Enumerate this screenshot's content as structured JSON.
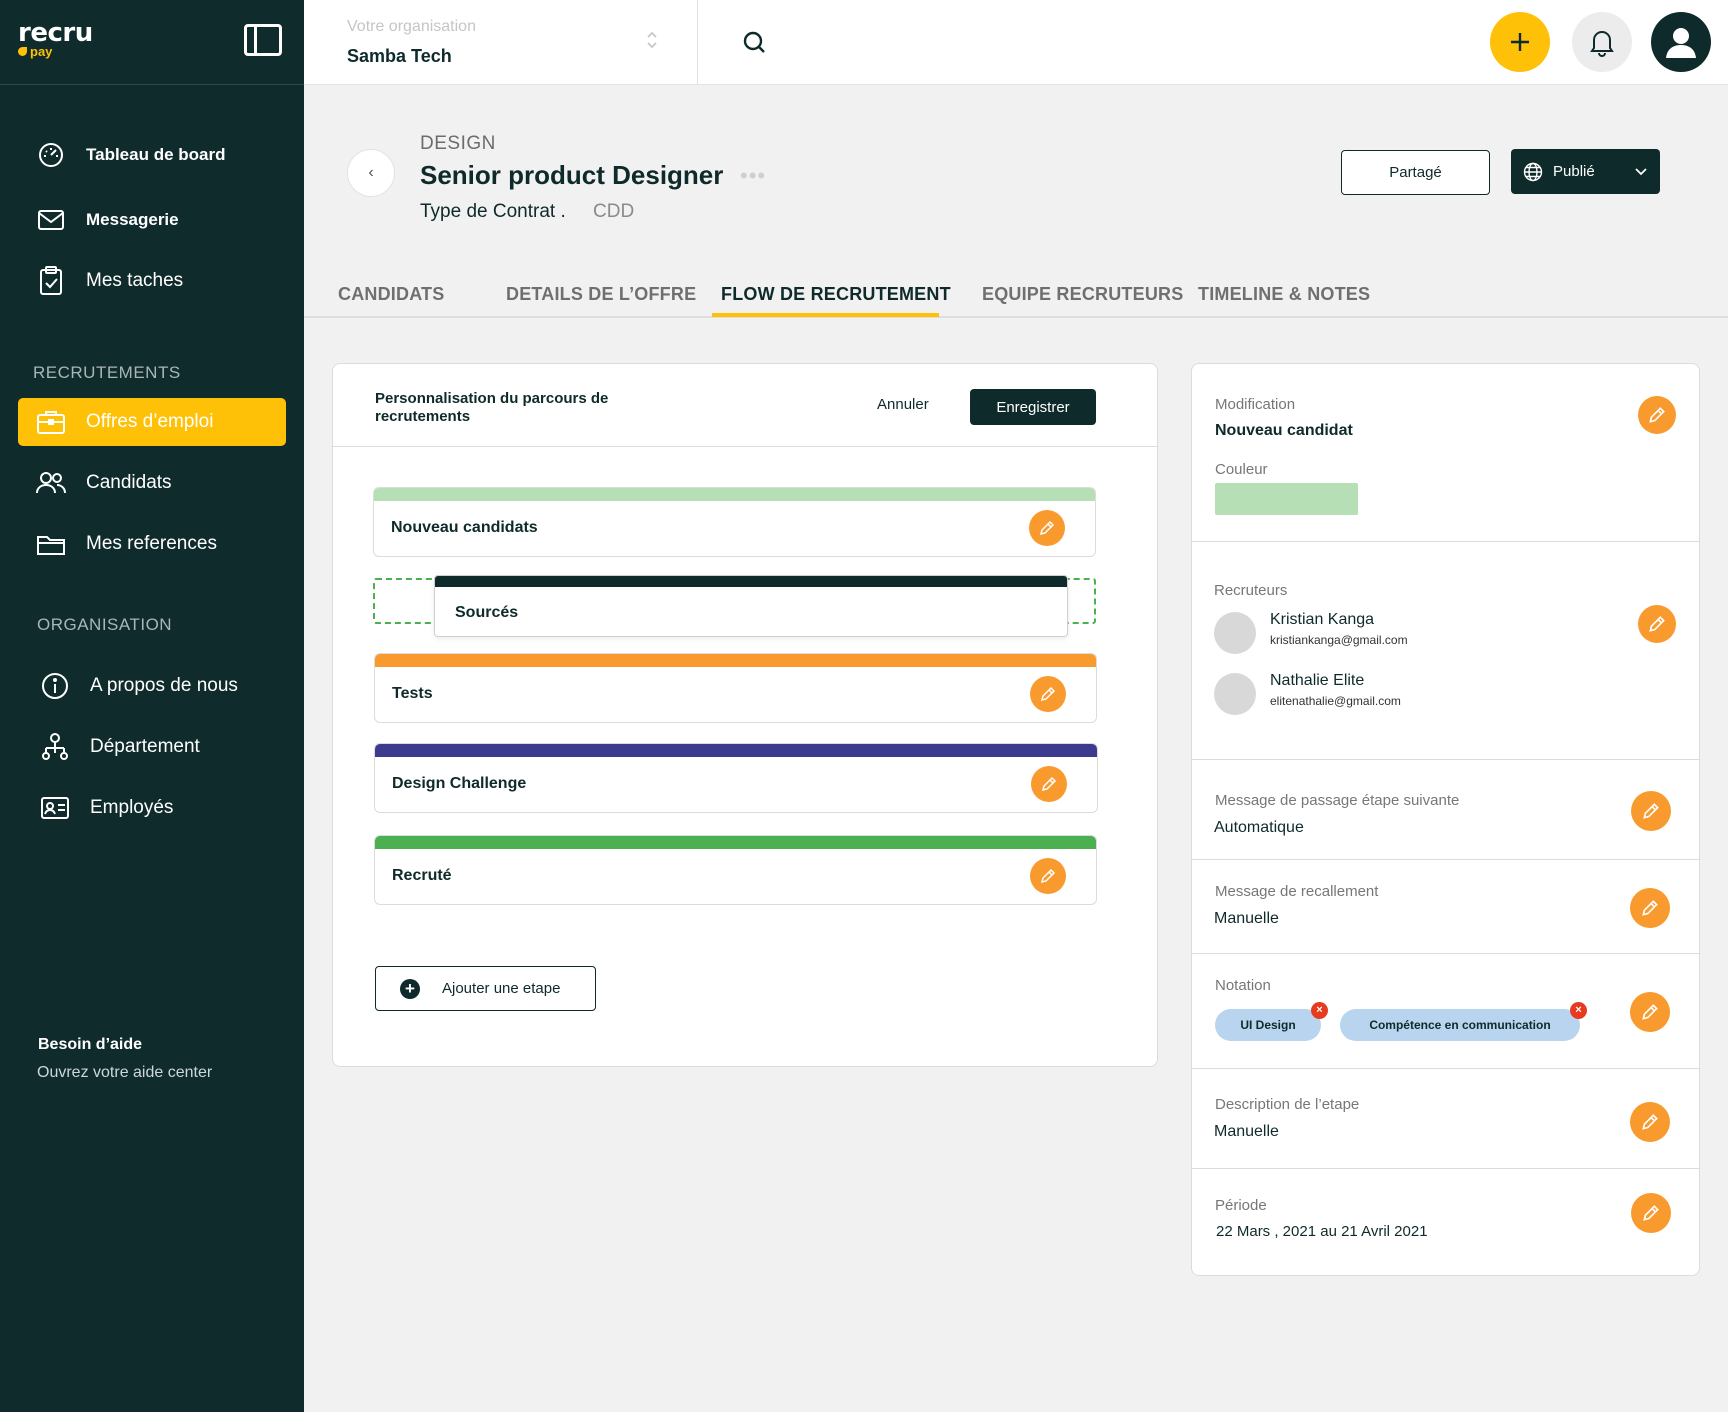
{
  "brand": {
    "logo_main": "recru",
    "logo_sub": "pay"
  },
  "sidebar": {
    "nav": [
      {
        "label": "Tableau de board"
      },
      {
        "label": "Messagerie"
      },
      {
        "label": "Mes taches"
      }
    ],
    "section_recruit": "RECRUTEMENTS",
    "recruit": [
      {
        "label": "Offres d’emploi"
      },
      {
        "label": "Candidats"
      },
      {
        "label": "Mes references"
      }
    ],
    "section_org": "ORGANISATION",
    "org": [
      {
        "label": "A propos de nous"
      },
      {
        "label": "Département"
      },
      {
        "label": "Employés"
      }
    ],
    "help_title": "Besoin d’aide",
    "help_sub": "Ouvrez votre aide center"
  },
  "topbar": {
    "org_label": "Votre organisation",
    "org_name": "Samba Tech"
  },
  "job": {
    "dept": "DESIGN",
    "title": "Senior product Designer",
    "dots": "•••",
    "contract_label": "Type de Contrat .",
    "contract_value": "CDD",
    "share_label": "Partagé",
    "publish_label": "Publié"
  },
  "tabs": [
    {
      "label": "CANDIDATS"
    },
    {
      "label": "DETAILS DE L’OFFRE"
    },
    {
      "label": "FLOW DE RECRUTEMENT"
    },
    {
      "label": "EQUIPE RECRUTEURS"
    },
    {
      "label": "TIMELINE & NOTES"
    }
  ],
  "flow": {
    "title": "Personnalisation du parcours de recrutements",
    "cancel": "Annuler",
    "save": "Enregistrer",
    "stages": [
      {
        "name": "Nouveau candidats",
        "color": "#b6dfb6"
      },
      {
        "name": "Sourcés",
        "color": "#0f2a2a"
      },
      {
        "name": "Tests",
        "color": "#f89a2e"
      },
      {
        "name": "Design Challenge",
        "color": "#3d3b8e"
      },
      {
        "name": "Recruté",
        "color": "#4caf50"
      }
    ],
    "add_step": "Ajouter une etape"
  },
  "details": {
    "modification_label": "Modification",
    "modification_value": "Nouveau candidat",
    "color_label": "Couleur",
    "color_value": "#b6dfb6",
    "recruiters_label": "Recruteurs",
    "recruiters": [
      {
        "name": "Kristian Kanga",
        "email": "kristiankanga@gmail.com"
      },
      {
        "name": "Nathalie Elite",
        "email": "elitenathalie@gmail.com"
      }
    ],
    "next_msg_label": "Message de passage étape suivante",
    "next_msg_value": "Automatique",
    "recall_label": "Message de recallement",
    "recall_value": "Manuelle",
    "notation_label": "Notation",
    "notation_chips": [
      {
        "label": "UI Design"
      },
      {
        "label": "Compétence en communication"
      }
    ],
    "desc_label": "Description de l’etape",
    "desc_value": "Manuelle",
    "period_label": "Période",
    "period_value": "22 Mars , 2021 au 21 Avril 2021"
  },
  "colors": {
    "sidebar": "#0f2b2b",
    "accent": "#ffc107",
    "edit": "#f89a2e"
  }
}
